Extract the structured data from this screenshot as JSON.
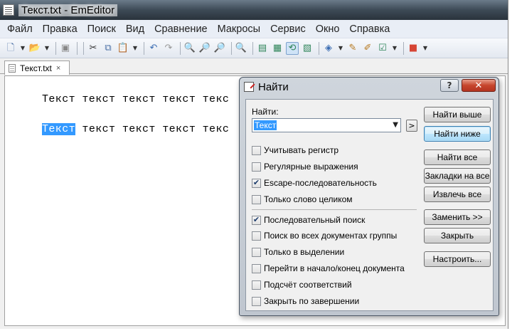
{
  "window": {
    "title": "Текст.txt - EmEditor"
  },
  "menu": [
    "Файл",
    "Правка",
    "Поиск",
    "Вид",
    "Сравнение",
    "Макросы",
    "Сервис",
    "Окно",
    "Справка"
  ],
  "tab": {
    "label": "Текст.txt",
    "close": "×"
  },
  "editor": {
    "lines": [
      {
        "highlight": "",
        "rest": "Текст текст текст текст текс"
      },
      {
        "highlight": "Текст",
        "rest": " текст текст текст текс"
      }
    ]
  },
  "dialog": {
    "title": "Найти",
    "help": "?",
    "close": "✕",
    "find_label": "Найти:",
    "find_value": "Текст",
    "expand": ">",
    "options": [
      {
        "label": "Учитывать регистр",
        "checked": false
      },
      {
        "label": "Регулярные выражения",
        "checked": false
      },
      {
        "label": "Escape-последовательность",
        "checked": true
      },
      {
        "label": "Только слово целиком",
        "checked": false
      },
      {
        "label": "Последовательный поиск",
        "checked": true
      },
      {
        "label": "Поиск во всех документах группы",
        "checked": false
      },
      {
        "label": "Только в выделении",
        "checked": false
      },
      {
        "label": "Перейти в начало/конец документа",
        "checked": false
      },
      {
        "label": "Подсчёт соответствий",
        "checked": false
      },
      {
        "label": "Закрыть по завершении",
        "checked": false
      }
    ],
    "buttons": {
      "find_prev": "Найти выше",
      "find_next": "Найти ниже",
      "find_all": "Найти все",
      "bookmark_all": "Закладки на все",
      "extract_all": "Извлечь все",
      "replace": "Заменить >>",
      "close": "Закрыть",
      "customize": "Настроить..."
    }
  },
  "colors": {
    "selection": "#3399ff",
    "close_button": "#c6452c"
  }
}
